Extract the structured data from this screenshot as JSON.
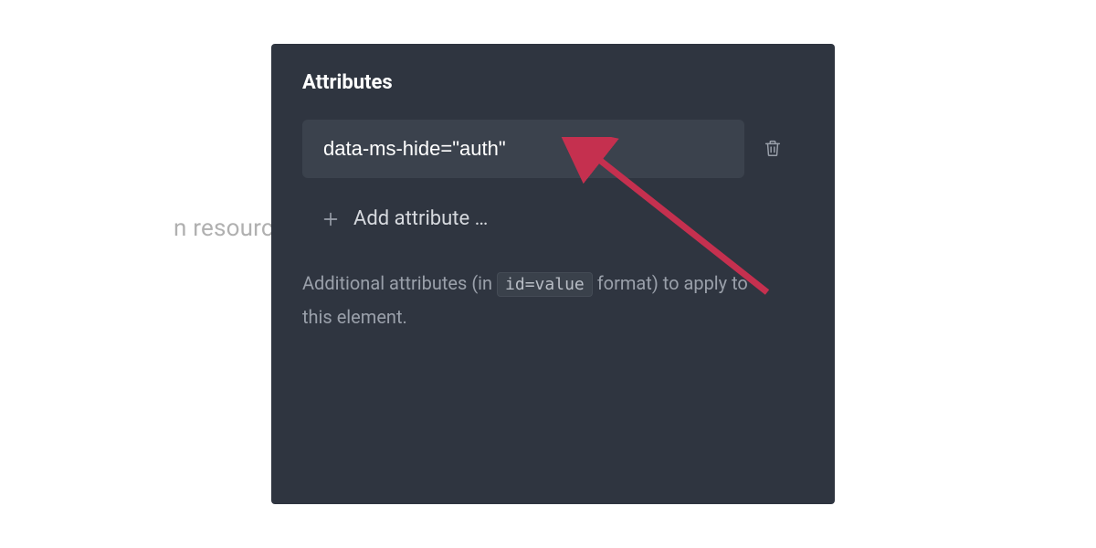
{
  "background_text": "n resources, that will",
  "panel": {
    "title": "Attributes",
    "attribute_value": "data-ms-hide=\"auth\"",
    "add_label": "Add attribute …",
    "helper_prefix": "Additional attributes (in ",
    "helper_code": "id=value",
    "helper_suffix": " format) to apply to this element."
  },
  "icons": {
    "trash": "trash-icon",
    "plus": "plus-icon"
  },
  "annotation": {
    "arrow_color": "#c5304f"
  }
}
